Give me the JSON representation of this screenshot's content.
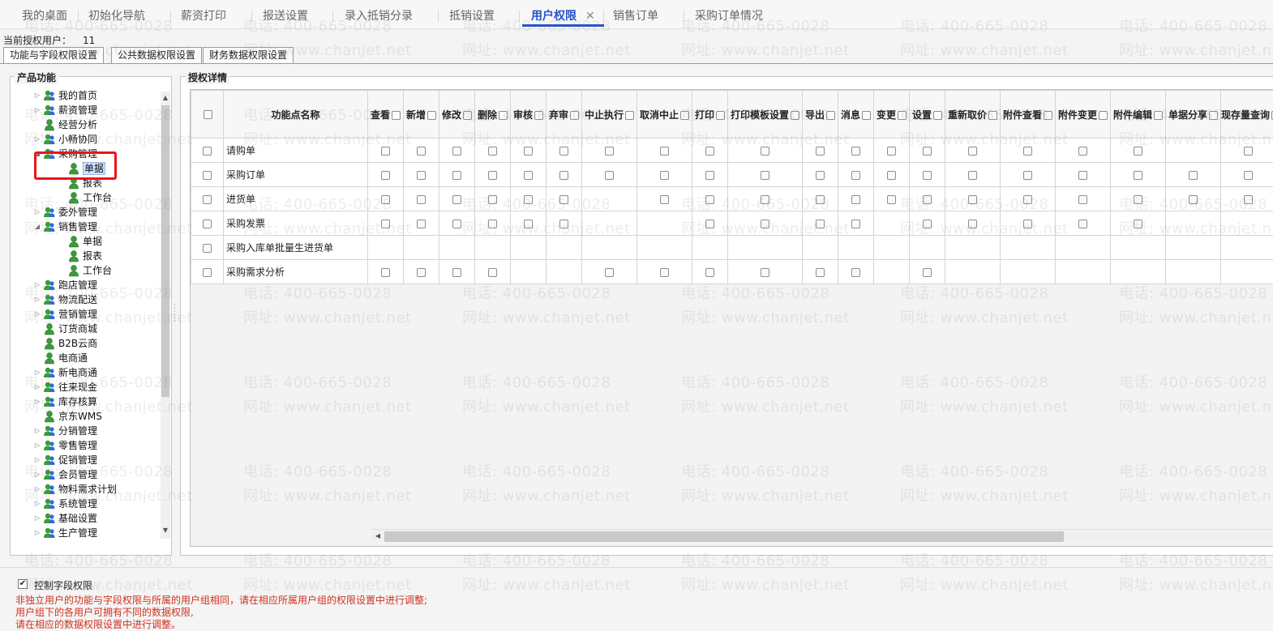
{
  "top_tabs": [
    {
      "label": "我的桌面"
    },
    {
      "label": "初始化导航"
    },
    {
      "label": "薪资打印"
    },
    {
      "label": "报送设置"
    },
    {
      "label": "录入抵销分录"
    },
    {
      "label": "抵销设置"
    },
    {
      "label": "用户权限",
      "active": true,
      "closable": true
    },
    {
      "label": "销售订单"
    },
    {
      "label": "采购订单情况"
    }
  ],
  "close_glyph": "✕",
  "current_user": {
    "label": "当前授权用户：",
    "value": "11"
  },
  "sub_tabs": [
    "功能与字段权限设置",
    "公共数据权限设置",
    "财务数据权限设置"
  ],
  "left_panel": {
    "title": "产品功能",
    "tree": [
      {
        "label": "我的首页",
        "level": 0,
        "state": "collapsed"
      },
      {
        "label": "薪资管理",
        "level": 0,
        "state": "collapsed"
      },
      {
        "label": "经营分析",
        "level": 0,
        "state": "leaf"
      },
      {
        "label": "小畅协同",
        "level": 0,
        "state": "collapsed"
      },
      {
        "label": "采购管理",
        "level": 0,
        "state": "expanded"
      },
      {
        "label": "单据",
        "level": 1,
        "state": "leaf",
        "selected": true
      },
      {
        "label": "报表",
        "level": 1,
        "state": "leaf"
      },
      {
        "label": "工作台",
        "level": 1,
        "state": "leaf"
      },
      {
        "label": "委外管理",
        "level": 0,
        "state": "collapsed"
      },
      {
        "label": "销售管理",
        "level": 0,
        "state": "expanded"
      },
      {
        "label": "单据",
        "level": 1,
        "state": "leaf"
      },
      {
        "label": "报表",
        "level": 1,
        "state": "leaf"
      },
      {
        "label": "工作台",
        "level": 1,
        "state": "leaf"
      },
      {
        "label": "跑店管理",
        "level": 0,
        "state": "collapsed"
      },
      {
        "label": "物流配送",
        "level": 0,
        "state": "collapsed"
      },
      {
        "label": "营销管理",
        "level": 0,
        "state": "collapsed"
      },
      {
        "label": "订货商城",
        "level": 0,
        "state": "leaf"
      },
      {
        "label": "B2B云商",
        "level": 0,
        "state": "leaf"
      },
      {
        "label": "电商通",
        "level": 0,
        "state": "leaf"
      },
      {
        "label": "新电商通",
        "level": 0,
        "state": "collapsed"
      },
      {
        "label": "往来现金",
        "level": 0,
        "state": "collapsed"
      },
      {
        "label": "库存核算",
        "level": 0,
        "state": "collapsed"
      },
      {
        "label": "京东WMS",
        "level": 0,
        "state": "leaf"
      },
      {
        "label": "分销管理",
        "level": 0,
        "state": "collapsed"
      },
      {
        "label": "零售管理",
        "level": 0,
        "state": "collapsed"
      },
      {
        "label": "促销管理",
        "level": 0,
        "state": "collapsed"
      },
      {
        "label": "会员管理",
        "level": 0,
        "state": "collapsed"
      },
      {
        "label": "物料需求计划",
        "level": 0,
        "state": "collapsed"
      },
      {
        "label": "系统管理",
        "level": 0,
        "state": "collapsed"
      },
      {
        "label": "基础设置",
        "level": 0,
        "state": "collapsed"
      },
      {
        "label": "生产管理",
        "level": 0,
        "state": "collapsed"
      }
    ]
  },
  "right_panel": {
    "title": "授权详情",
    "name_header": "功能点名称",
    "columns": [
      "查看",
      "新增",
      "修改",
      "删除",
      "审核",
      "弃审",
      "中止执行",
      "取消中止",
      "打印",
      "打印模板设置",
      "导出",
      "消息",
      "变更",
      "设置",
      "重新取价",
      "附件查看",
      "附件变更",
      "附件编辑",
      "单据分享",
      "现存量查询"
    ],
    "rows": [
      {
        "name": "请购单",
        "cells": [
          1,
          1,
          1,
          1,
          1,
          1,
          1,
          1,
          1,
          1,
          1,
          1,
          1,
          1,
          1,
          1,
          1,
          1,
          0,
          1
        ]
      },
      {
        "name": "采购订单",
        "cells": [
          1,
          1,
          1,
          1,
          1,
          1,
          1,
          1,
          1,
          1,
          1,
          1,
          1,
          1,
          1,
          1,
          1,
          1,
          1,
          1
        ]
      },
      {
        "name": "进货单",
        "cells": [
          1,
          1,
          1,
          1,
          1,
          1,
          0,
          1,
          1,
          1,
          1,
          1,
          1,
          1,
          1,
          1,
          1,
          1,
          1,
          1
        ]
      },
      {
        "name": "采购发票",
        "cells": [
          1,
          1,
          1,
          1,
          1,
          1,
          0,
          0,
          1,
          1,
          1,
          1,
          0,
          1,
          1,
          1,
          1,
          1,
          0,
          0
        ]
      },
      {
        "name": "采购入库单批量生进货单",
        "cells": [
          0,
          0,
          0,
          0,
          0,
          0,
          0,
          0,
          0,
          0,
          0,
          0,
          0,
          0,
          0,
          0,
          0,
          0,
          0,
          0
        ]
      },
      {
        "name": "采购需求分析",
        "cells": [
          1,
          1,
          1,
          1,
          0,
          0,
          1,
          1,
          1,
          1,
          1,
          1,
          0,
          1,
          0,
          0,
          0,
          0,
          0,
          0
        ]
      }
    ]
  },
  "footer": {
    "control_field_label": "控制字段权限",
    "control_field_checked": true,
    "check_glyph": "✔",
    "notices": [
      "非独立用户的功能与字段权限与所属的用户组相同，请在相应所属用户组的权限设置中进行调整;",
      "用户组下的各用户可拥有不同的数据权限,",
      "请在相应的数据权限设置中进行调整。"
    ]
  },
  "watermark": {
    "phone": "电话: 400-665-0028",
    "site": "网址: www.chanjet.net"
  }
}
